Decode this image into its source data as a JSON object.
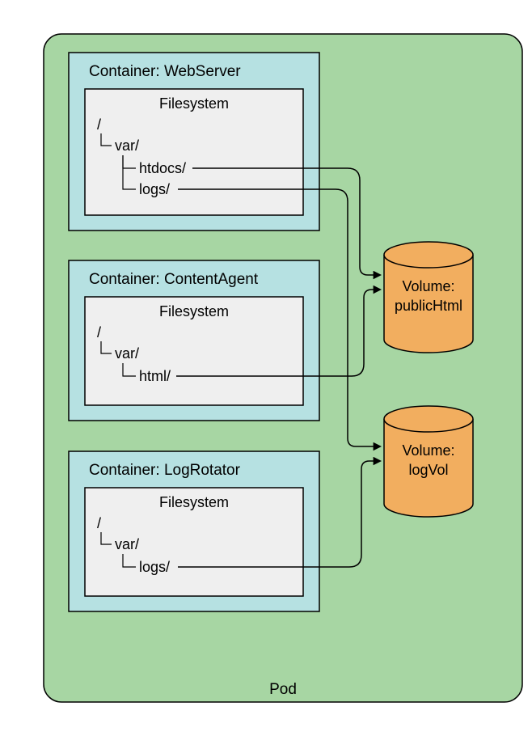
{
  "pod": {
    "label": "Pod"
  },
  "containers": [
    {
      "name": "WebServer",
      "title": "Container: WebServer",
      "fs_label": "Filesystem",
      "tree": {
        "root": "/",
        "l1": "var/",
        "l2a": "htdocs/",
        "l2b": "logs/"
      }
    },
    {
      "name": "ContentAgent",
      "title": "Container: ContentAgent",
      "fs_label": "Filesystem",
      "tree": {
        "root": "/",
        "l1": "var/",
        "l2a": "html/"
      }
    },
    {
      "name": "LogRotator",
      "title": "Container: LogRotator",
      "fs_label": "Filesystem",
      "tree": {
        "root": "/",
        "l1": "var/",
        "l2a": "logs/"
      }
    }
  ],
  "volumes": [
    {
      "name": "publicHtml",
      "title": "Volume:",
      "value": "publicHtml"
    },
    {
      "name": "logVol",
      "title": "Volume:",
      "value": "logVol"
    }
  ],
  "colors": {
    "pod": "#A7D6A3",
    "container": "#B6E1E2",
    "fs": "#EFEFEF",
    "volume": "#F2AE5F",
    "volumeTop": "#E99F47",
    "stroke": "#000000"
  }
}
